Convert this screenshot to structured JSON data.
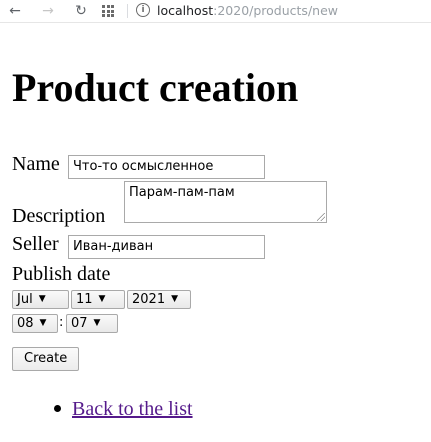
{
  "browser": {
    "back_icon": "arrow-left",
    "forward_icon": "arrow-right",
    "reload_icon": "reload",
    "url_host": "localhost",
    "url_path": ":2020/products/new"
  },
  "page": {
    "title": "Product creation"
  },
  "form": {
    "name_label": "Name",
    "name_value": "Что-то осмысленное",
    "description_label": "Description",
    "description_value": "Парам-пам-пам",
    "seller_label": "Seller",
    "seller_value": "Иван-диван",
    "publish_date_label": "Publish date",
    "month_value": "Jul",
    "day_value": "11",
    "year_value": "2021",
    "hour_value": "08",
    "time_separator": ":",
    "minute_value": "07",
    "submit_label": "Create"
  },
  "links": {
    "back_label": "Back to the list"
  },
  "colors": {
    "link": "#551a8b",
    "border": "#a9a9a9"
  }
}
